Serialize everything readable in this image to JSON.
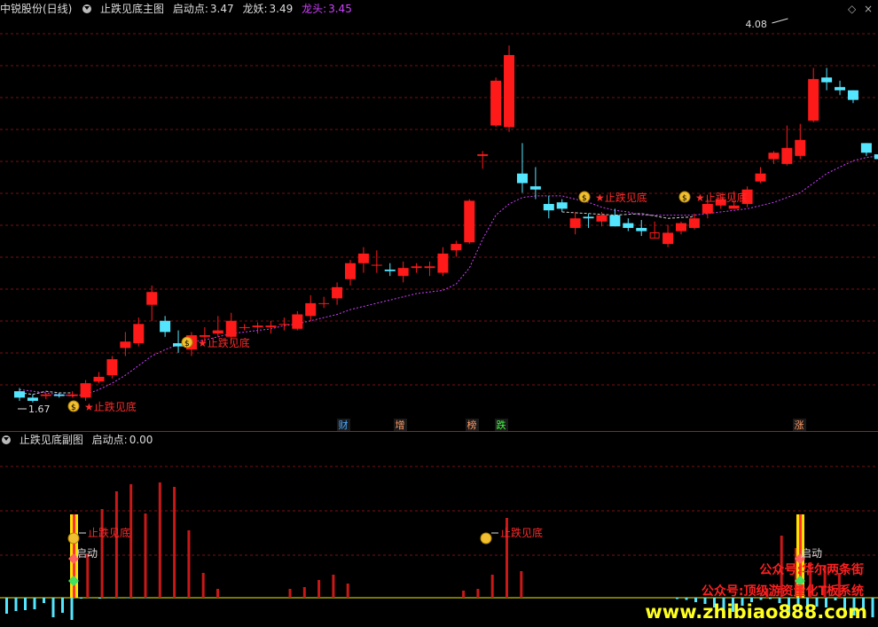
{
  "main_header": {
    "stock_name": "中锐股份(日线)",
    "indicator_name": "止跌见底主图",
    "start_label": "启动点:",
    "start_value": "3.47",
    "dragon_label": "龙妖:",
    "dragon_value": "3.49",
    "head_label": "龙头:",
    "head_value": "3.45"
  },
  "sub_header": {
    "indicator_name": "止跌见底副图",
    "start_label": "启动点:",
    "start_value": "0.00"
  },
  "window_controls": {
    "diamond_icon": "◇",
    "close_icon": "×"
  },
  "colors": {
    "up": "#ff1a1a",
    "down": "#55e6ff",
    "ma": "#d040ff",
    "grid": "#7a1010",
    "separator": "#c01010",
    "marker_text": "#ff2a2a",
    "tag_bg": "#1a1a1a"
  },
  "price_labels": {
    "high": "4.08",
    "low": "1.67"
  },
  "markers": [
    {
      "label": "★止跌见底",
      "icon": "money-bag-icon"
    },
    {
      "label": "★止跌见底",
      "icon": "money-bag-icon"
    },
    {
      "label": "★止跌见底",
      "icon": "money-bag-icon"
    },
    {
      "label": "★止跌见底",
      "icon": "money-bag-icon"
    }
  ],
  "event_tags": [
    {
      "text": "财",
      "color": "#4aa8ff"
    },
    {
      "text": "增",
      "color": "#ff9a66"
    },
    {
      "text": "榜",
      "color": "#ff9a66"
    },
    {
      "text": "跌",
      "color": "#40ff40"
    },
    {
      "text": "涨",
      "color": "#ff9a66"
    }
  ],
  "sub_markers": [
    {
      "label": "止跌见底"
    },
    {
      "label": "止跌见底"
    }
  ],
  "sub_start_labels": [
    "启动",
    "启动"
  ],
  "watermarks": [
    {
      "text": "公众号:华尔两条街",
      "color": "#ff2020"
    },
    {
      "text": "公众号:顶级游资量化T板系统",
      "color": "#ff2020"
    },
    {
      "text": "www.zhibiao888.com",
      "color": "#ffff20"
    }
  ],
  "chart_data": {
    "type": "candlestick",
    "ylim": [
      1.6,
      4.12
    ],
    "candles": [
      [
        1.78,
        1.74,
        1.8,
        1.72
      ],
      [
        1.74,
        1.72,
        1.76,
        1.71
      ],
      [
        1.75,
        1.76,
        1.77,
        1.73
      ],
      [
        1.76,
        1.75,
        1.77,
        1.74
      ],
      [
        1.75,
        1.76,
        1.78,
        1.74
      ],
      [
        1.74,
        1.83,
        1.85,
        1.72
      ],
      [
        1.84,
        1.87,
        1.9,
        1.83
      ],
      [
        1.88,
        1.98,
        2.0,
        1.86
      ],
      [
        2.05,
        2.09,
        2.15,
        2.0
      ],
      [
        2.08,
        2.2,
        2.24,
        2.06
      ],
      [
        2.32,
        2.4,
        2.44,
        2.22
      ],
      [
        2.22,
        2.15,
        2.25,
        2.12
      ],
      [
        2.08,
        2.06,
        2.16,
        2.02
      ],
      [
        2.04,
        2.13,
        2.15,
        2.0
      ],
      [
        2.12,
        2.13,
        2.18,
        2.08
      ],
      [
        2.14,
        2.16,
        2.25,
        2.12
      ],
      [
        2.12,
        2.22,
        2.27,
        2.08
      ],
      [
        2.18,
        2.18,
        2.2,
        2.16
      ],
      [
        2.18,
        2.19,
        2.21,
        2.14
      ],
      [
        2.18,
        2.19,
        2.22,
        2.14
      ],
      [
        2.2,
        2.2,
        2.24,
        2.16
      ],
      [
        2.17,
        2.26,
        2.28,
        2.16
      ],
      [
        2.25,
        2.33,
        2.38,
        2.22
      ],
      [
        2.33,
        2.33,
        2.37,
        2.3
      ],
      [
        2.36,
        2.43,
        2.46,
        2.32
      ],
      [
        2.48,
        2.58,
        2.6,
        2.44
      ],
      [
        2.58,
        2.64,
        2.68,
        2.52
      ],
      [
        2.57,
        2.57,
        2.66,
        2.52
      ],
      [
        2.54,
        2.53,
        2.58,
        2.5
      ],
      [
        2.5,
        2.55,
        2.59,
        2.46
      ],
      [
        2.55,
        2.56,
        2.58,
        2.52
      ],
      [
        2.55,
        2.56,
        2.59,
        2.5
      ],
      [
        2.52,
        2.64,
        2.68,
        2.5
      ],
      [
        2.66,
        2.7,
        2.72,
        2.62
      ],
      [
        2.71,
        2.97,
        2.98,
        2.7
      ],
      [
        3.25,
        3.26,
        3.28,
        3.17
      ],
      [
        3.44,
        3.72,
        3.74,
        3.43
      ],
      [
        3.43,
        3.88,
        3.94,
        3.4
      ],
      [
        3.14,
        3.08,
        3.33,
        3.02
      ],
      [
        3.06,
        3.04,
        3.18,
        2.98
      ],
      [
        2.95,
        2.91,
        3.0,
        2.86
      ],
      [
        2.96,
        2.92,
        2.98,
        2.9
      ],
      [
        2.8,
        2.86,
        2.9,
        2.76
      ],
      [
        2.87,
        2.86,
        2.89,
        2.8
      ],
      [
        2.84,
        2.88,
        2.9,
        2.81
      ],
      [
        2.88,
        2.81,
        2.92,
        2.81
      ],
      [
        2.83,
        2.8,
        2.86,
        2.78
      ],
      [
        2.8,
        2.78,
        2.85,
        2.75
      ],
      [
        2.76,
        2.77,
        2.84,
        2.74
      ],
      [
        2.7,
        2.77,
        2.82,
        2.68
      ],
      [
        2.78,
        2.83,
        2.84,
        2.76
      ],
      [
        2.8,
        2.86,
        2.89,
        2.79
      ],
      [
        2.89,
        2.95,
        2.98,
        2.86
      ],
      [
        2.94,
        2.98,
        3.0,
        2.92
      ],
      [
        2.92,
        2.94,
        3.03,
        2.92
      ],
      [
        2.95,
        3.04,
        3.06,
        2.93
      ],
      [
        3.09,
        3.14,
        3.18,
        3.08
      ],
      [
        3.23,
        3.27,
        3.28,
        3.2
      ],
      [
        3.2,
        3.3,
        3.44,
        3.19
      ],
      [
        3.25,
        3.35,
        3.45,
        3.23
      ],
      [
        3.47,
        3.73,
        3.8,
        3.46
      ],
      [
        3.74,
        3.71,
        3.8,
        3.66
      ],
      [
        3.68,
        3.66,
        3.72,
        3.63
      ],
      [
        3.66,
        3.6,
        3.66,
        3.58
      ],
      [
        3.33,
        3.27,
        3.33,
        3.25
      ],
      [
        3.26,
        3.23,
        3.3,
        3.2
      ]
    ],
    "ma": [
      1.79,
      1.78,
      1.77,
      1.76,
      1.75,
      1.76,
      1.79,
      1.83,
      1.88,
      1.94,
      2.0,
      2.04,
      2.07,
      2.09,
      2.1,
      2.12,
      2.14,
      2.15,
      2.16,
      2.17,
      2.19,
      2.2,
      2.22,
      2.24,
      2.26,
      2.29,
      2.31,
      2.33,
      2.35,
      2.37,
      2.39,
      2.4,
      2.41,
      2.45,
      2.55,
      2.73,
      2.88,
      2.95,
      2.99,
      3.0,
      3.0,
      3.0,
      2.98,
      2.96,
      2.93,
      2.91,
      2.9,
      2.88,
      2.88,
      2.88,
      2.88,
      2.88,
      2.89,
      2.9,
      2.91,
      2.92,
      2.94,
      2.96,
      2.99,
      3.02,
      3.08,
      3.14,
      3.18,
      3.22,
      3.24,
      3.25
    ],
    "sub_bars": [
      -36,
      -30,
      -28,
      -26,
      -12,
      -44,
      -34,
      -50,
      -2,
      -1,
      -2,
      -1,
      -1,
      -1,
      -1,
      -1,
      0,
      0,
      0,
      0,
      0,
      0,
      0,
      0,
      0,
      0,
      0,
      0,
      0,
      0,
      0,
      0,
      0,
      0,
      0,
      0,
      0,
      0,
      0,
      0,
      0,
      0,
      0,
      0,
      0,
      0,
      0,
      0,
      0,
      0,
      0,
      0,
      0,
      0,
      0,
      0,
      0,
      0,
      0,
      0,
      0,
      0,
      0,
      0,
      0,
      0,
      0,
      0,
      0,
      0,
      0,
      0,
      -3,
      -5,
      -10,
      -14,
      -22,
      -28,
      -32,
      -18,
      -10,
      -5,
      -3,
      -12,
      -40,
      -20,
      -40,
      -20,
      -22,
      -6,
      -26,
      -40,
      -28,
      -44
    ],
    "sub_red": [
      {
        "i": 5,
        "v": 66
      },
      {
        "i": 6,
        "v": 50
      },
      {
        "i": 7,
        "v": 100
      },
      {
        "i": 8,
        "v": 120
      },
      {
        "i": 9,
        "v": 128
      },
      {
        "i": 10,
        "v": 95
      },
      {
        "i": 11,
        "v": 130
      },
      {
        "i": 12,
        "v": 125
      },
      {
        "i": 13,
        "v": 76
      },
      {
        "i": 14,
        "v": 28
      },
      {
        "i": 15,
        "v": 10
      },
      {
        "i": 20,
        "v": 10
      },
      {
        "i": 21,
        "v": 12
      },
      {
        "i": 22,
        "v": 20
      },
      {
        "i": 23,
        "v": 26
      },
      {
        "i": 24,
        "v": 16
      },
      {
        "i": 32,
        "v": 8
      },
      {
        "i": 33,
        "v": 10
      },
      {
        "i": 34,
        "v": 26
      },
      {
        "i": 35,
        "v": 90
      },
      {
        "i": 36,
        "v": 30
      },
      {
        "i": 53,
        "v": 10
      },
      {
        "i": 54,
        "v": 70
      },
      {
        "i": 55,
        "v": 56
      },
      {
        "i": 56,
        "v": 40
      },
      {
        "i": 57,
        "v": 36
      },
      {
        "i": 58,
        "v": 28
      }
    ]
  }
}
